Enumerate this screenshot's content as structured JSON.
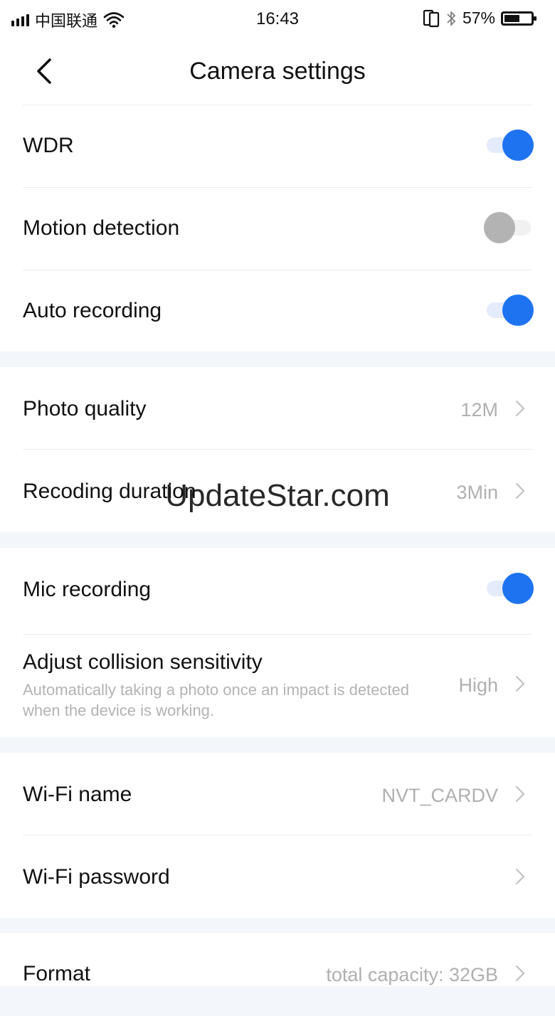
{
  "status_bar": {
    "carrier": "中国联通",
    "time": "16:43",
    "battery_text": "57%",
    "battery_level": 0.57
  },
  "header": {
    "title": "Camera settings"
  },
  "settings": {
    "wdr": {
      "label": "WDR",
      "enabled": true
    },
    "motion_detection": {
      "label": "Motion detection",
      "enabled": false
    },
    "auto_recording": {
      "label": "Auto recording",
      "enabled": true
    },
    "photo_quality": {
      "label": "Photo quality",
      "value": "12M"
    },
    "recording_duration": {
      "label": "Recoding duration",
      "value": "3Min"
    },
    "mic_recording": {
      "label": "Mic recording",
      "enabled": true
    },
    "collision_sensitivity": {
      "label": "Adjust collision sensitivity",
      "description": "Automatically taking a photo once an impact is detected when the device is working.",
      "value": "High"
    },
    "wifi_name": {
      "label": "Wi-Fi name",
      "value": "NVT_CARDV"
    },
    "wifi_password": {
      "label": "Wi-Fi password"
    },
    "format": {
      "label": "Format",
      "value": "total capacity: 32GB"
    }
  },
  "watermark": "UpdateStar.com",
  "colors": {
    "accent": "#1e73f0",
    "toggle_off": "#b3b3b3",
    "section_gap": "#f3f6fb"
  }
}
